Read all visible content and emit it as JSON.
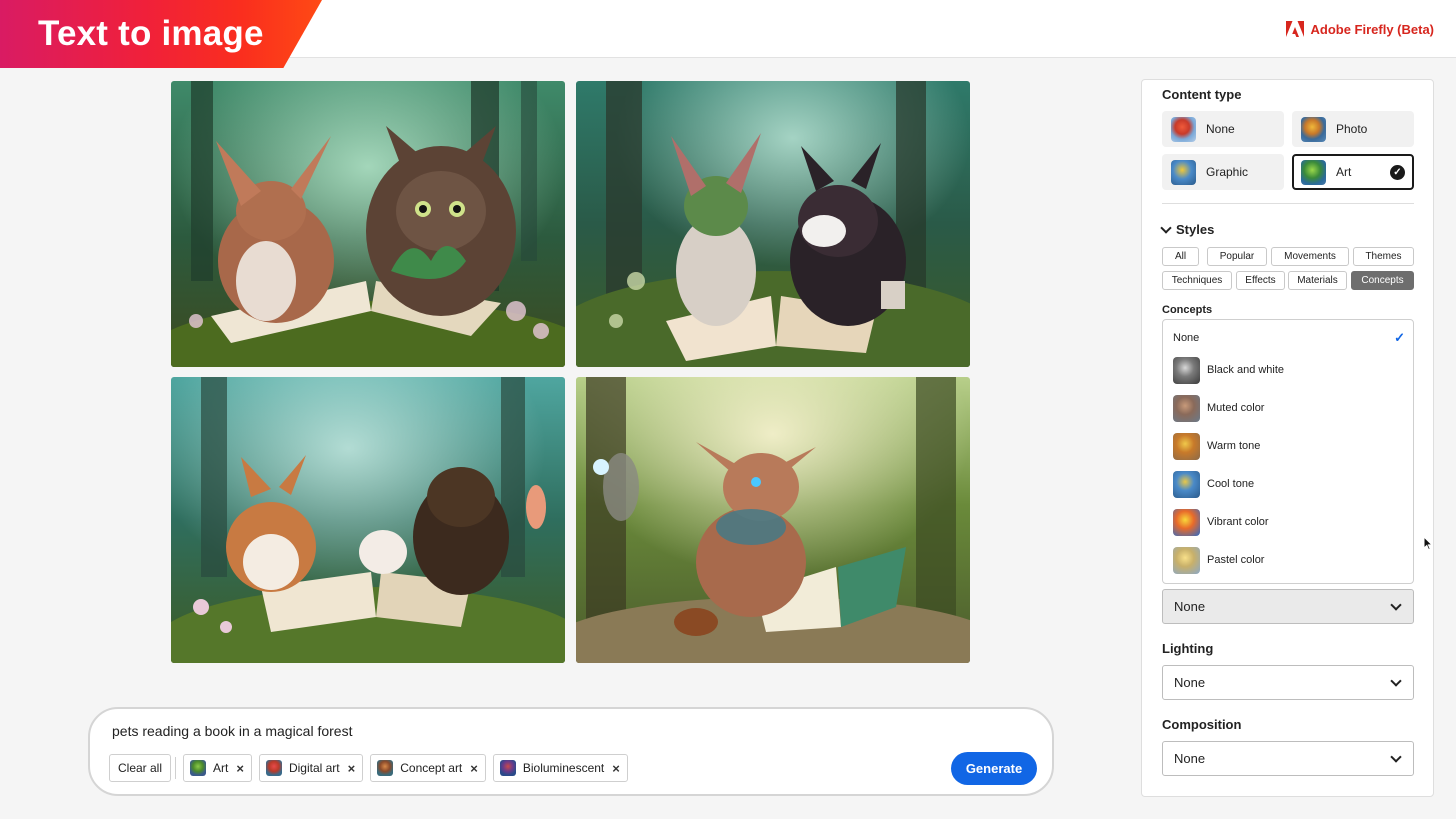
{
  "header": {
    "title": "Text to image",
    "brand": "Adobe Firefly (Beta)",
    "brand_color": "#d7261e"
  },
  "gallery": {
    "images": [
      {
        "alt": "pets reading a book in a magical forest",
        "icon": "generated-image"
      },
      {
        "alt": "pets reading a book in a magical forest",
        "icon": "generated-image"
      },
      {
        "alt": "pets reading a book in a magical forest",
        "icon": "generated-image"
      },
      {
        "alt": "pets reading a book in a magical forest",
        "icon": "generated-image"
      }
    ]
  },
  "prompt": {
    "text": "pets reading a book in a magical forest",
    "clear_label": "Clear all",
    "tags": [
      {
        "label": "Art",
        "icon": "balloon-thumb"
      },
      {
        "label": "Digital art",
        "icon": "balloon-thumb"
      },
      {
        "label": "Concept art",
        "icon": "balloon-thumb"
      },
      {
        "label": "Bioluminescent",
        "icon": "balloon-thumb"
      }
    ],
    "remove_glyph": "×",
    "generate_label": "Generate",
    "generate_color": "#1166e5"
  },
  "panel": {
    "content_type": {
      "heading": "Content type",
      "options": [
        {
          "label": "None",
          "selected": false
        },
        {
          "label": "Photo",
          "selected": false
        },
        {
          "label": "Graphic",
          "selected": false
        },
        {
          "label": "Art",
          "selected": true
        }
      ],
      "check_glyph": "✓"
    },
    "styles": {
      "heading": "Styles",
      "tabs": [
        "All",
        "Popular",
        "Movements",
        "Themes",
        "Techniques",
        "Effects",
        "Materials",
        "Concepts"
      ],
      "active_tab": "Concepts"
    },
    "concepts": {
      "heading": "Concepts",
      "items": [
        "None",
        "Black and white",
        "Muted color",
        "Warm tone",
        "Cool tone",
        "Vibrant color",
        "Pastel color"
      ],
      "selected": "None",
      "check_glyph": "✓",
      "select_value": "None"
    },
    "lighting": {
      "heading": "Lighting",
      "value": "None"
    },
    "composition": {
      "heading": "Composition",
      "value": "None"
    }
  }
}
